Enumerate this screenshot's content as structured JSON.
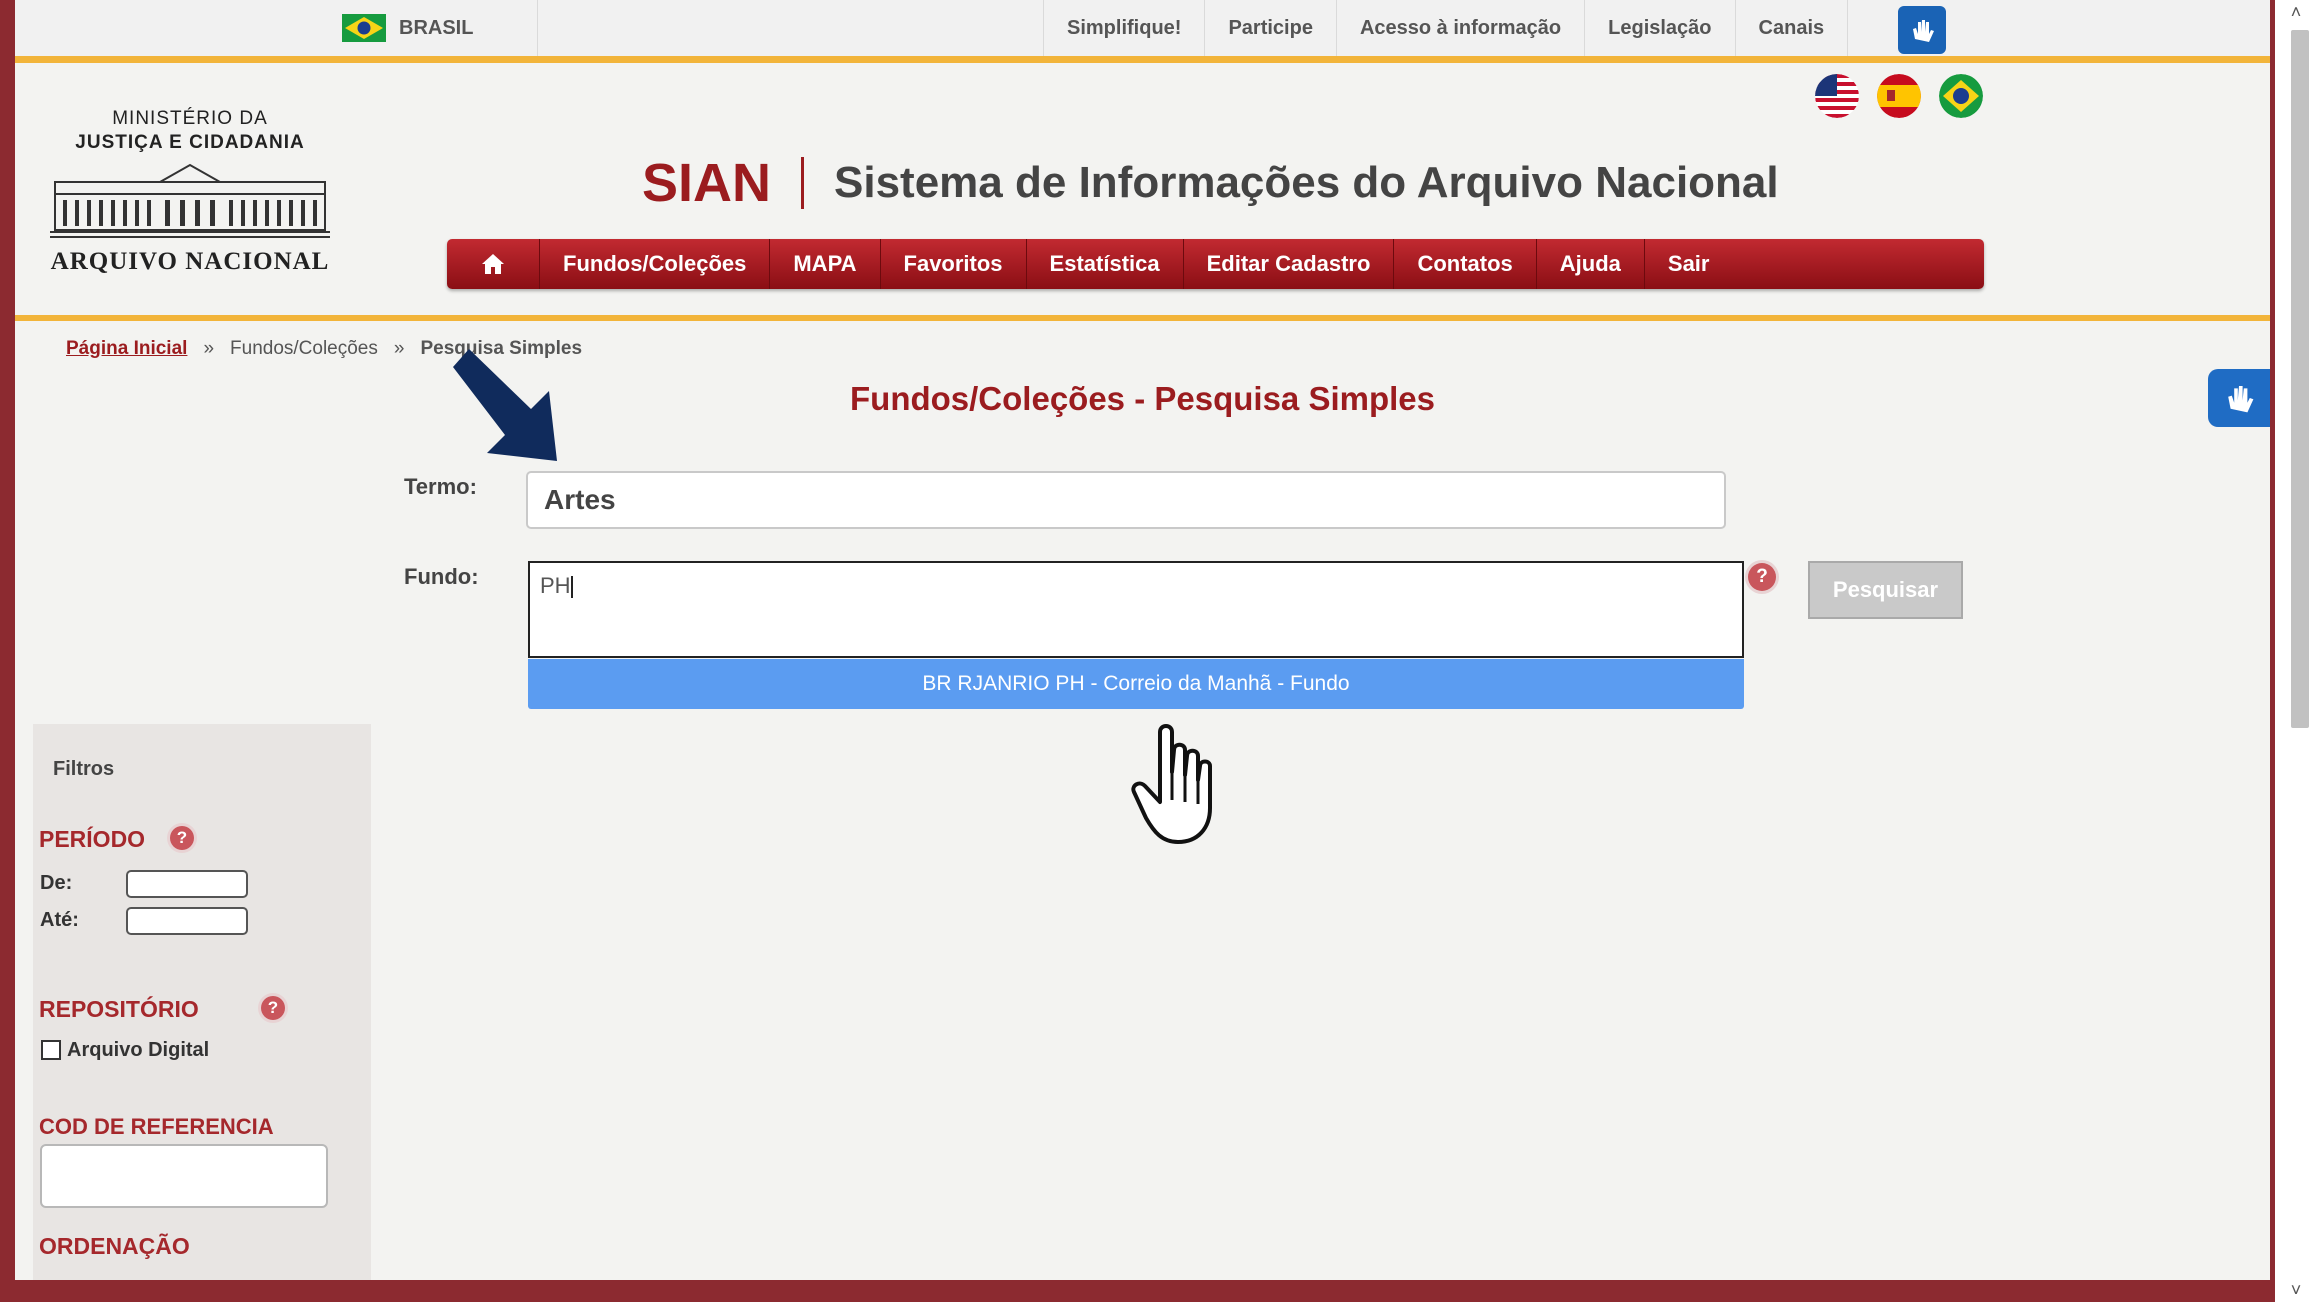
{
  "gov_bar": {
    "country": "BRASIL",
    "links": [
      "Simplifique!",
      "Participe",
      "Acesso à informação",
      "Legislação",
      "Canais"
    ],
    "accessibility_icon": "hand-sign-language-icon"
  },
  "header": {
    "logo": {
      "line1": "MINISTÉRIO DA",
      "line2": "JUSTIÇA E CIDADANIA",
      "line3": "ARQUIVO NACIONAL"
    },
    "system_short": "SIAN",
    "system_full": "Sistema de Informações do Arquivo Nacional",
    "language_flags": [
      "us-flag-icon",
      "spain-flag-icon",
      "brazil-flag-icon"
    ]
  },
  "nav": {
    "home_icon": "home-icon",
    "items": [
      "Fundos/Coleções",
      "MAPA",
      "Favoritos",
      "Estatística",
      "Editar Cadastro",
      "Contatos",
      "Ajuda",
      "Sair"
    ]
  },
  "breadcrumb": {
    "home": "Página Inicial",
    "separator": "»",
    "section": "Fundos/Coleções",
    "current": "Pesquisa Simples"
  },
  "page_title": "Fundos/Coleções - Pesquisa Simples",
  "form": {
    "termo_label": "Termo:",
    "termo_value": "Artes",
    "fundo_label": "Fundo:",
    "fundo_value": "PH",
    "help_symbol": "?",
    "search_button": "Pesquisar",
    "suggestion": "BR RJANRIO PH - Correio da Manhã - Fundo"
  },
  "filters": {
    "title": "Filtros",
    "periodo": "PERÍODO",
    "de_label": "De:",
    "ate_label": "Até:",
    "repositorio": "REPOSITÓRIO",
    "arquivo_digital": "Arquivo Digital",
    "cod_referencia": "COD DE REFERENCIA",
    "ordenacao": "ORDENAÇÃO"
  },
  "colors": {
    "brand_red": "#9b1c1f",
    "gold_rule": "#f2b43a",
    "suggestion_blue": "#5b9cf1",
    "outer_frame": "#8c2a30"
  }
}
